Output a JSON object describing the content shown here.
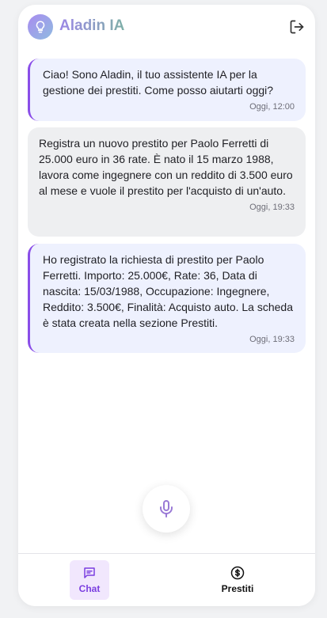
{
  "header": {
    "title": "Aladin IA",
    "logo_icon": "lightbulb-icon",
    "logout_icon": "logout-icon"
  },
  "messages": [
    {
      "role": "assistant",
      "text": "Ciao! Sono Aladin, il tuo assistente IA per la gestione dei prestiti. Come posso aiutarti oggi?",
      "time": "Oggi, 12:00"
    },
    {
      "role": "user",
      "text": "Registra un nuovo prestito per Paolo Ferretti di 25.000 euro in 36 rate. È nato il 15 marzo 1988, lavora come ingegnere con un reddito di 3.500 euro al mese e vuole il prestito per l'acquisto di un'auto.",
      "time": "Oggi, 19:33"
    },
    {
      "role": "assistant",
      "text": "Ho registrato la richiesta di prestito per Paolo Ferretti. Importo: 25.000€, Rate: 36, Data di nascita: 15/03/1988, Occupazione: Ingegnere, Reddito: 3.500€, Finalità: Acquisto auto. La scheda è stata creata nella sezione Prestiti.",
      "time": "Oggi, 19:33"
    }
  ],
  "mic": {
    "icon": "microphone-icon"
  },
  "nav": {
    "chat": {
      "label": "Chat",
      "icon": "chat-icon",
      "active": true
    },
    "prestiti": {
      "label": "Prestiti",
      "icon": "dollar-circle-icon",
      "active": false
    }
  },
  "colors": {
    "accent": "#7b3fe0",
    "assistant_bubble": "#eef1fe",
    "user_bubble": "#eeeff1"
  }
}
